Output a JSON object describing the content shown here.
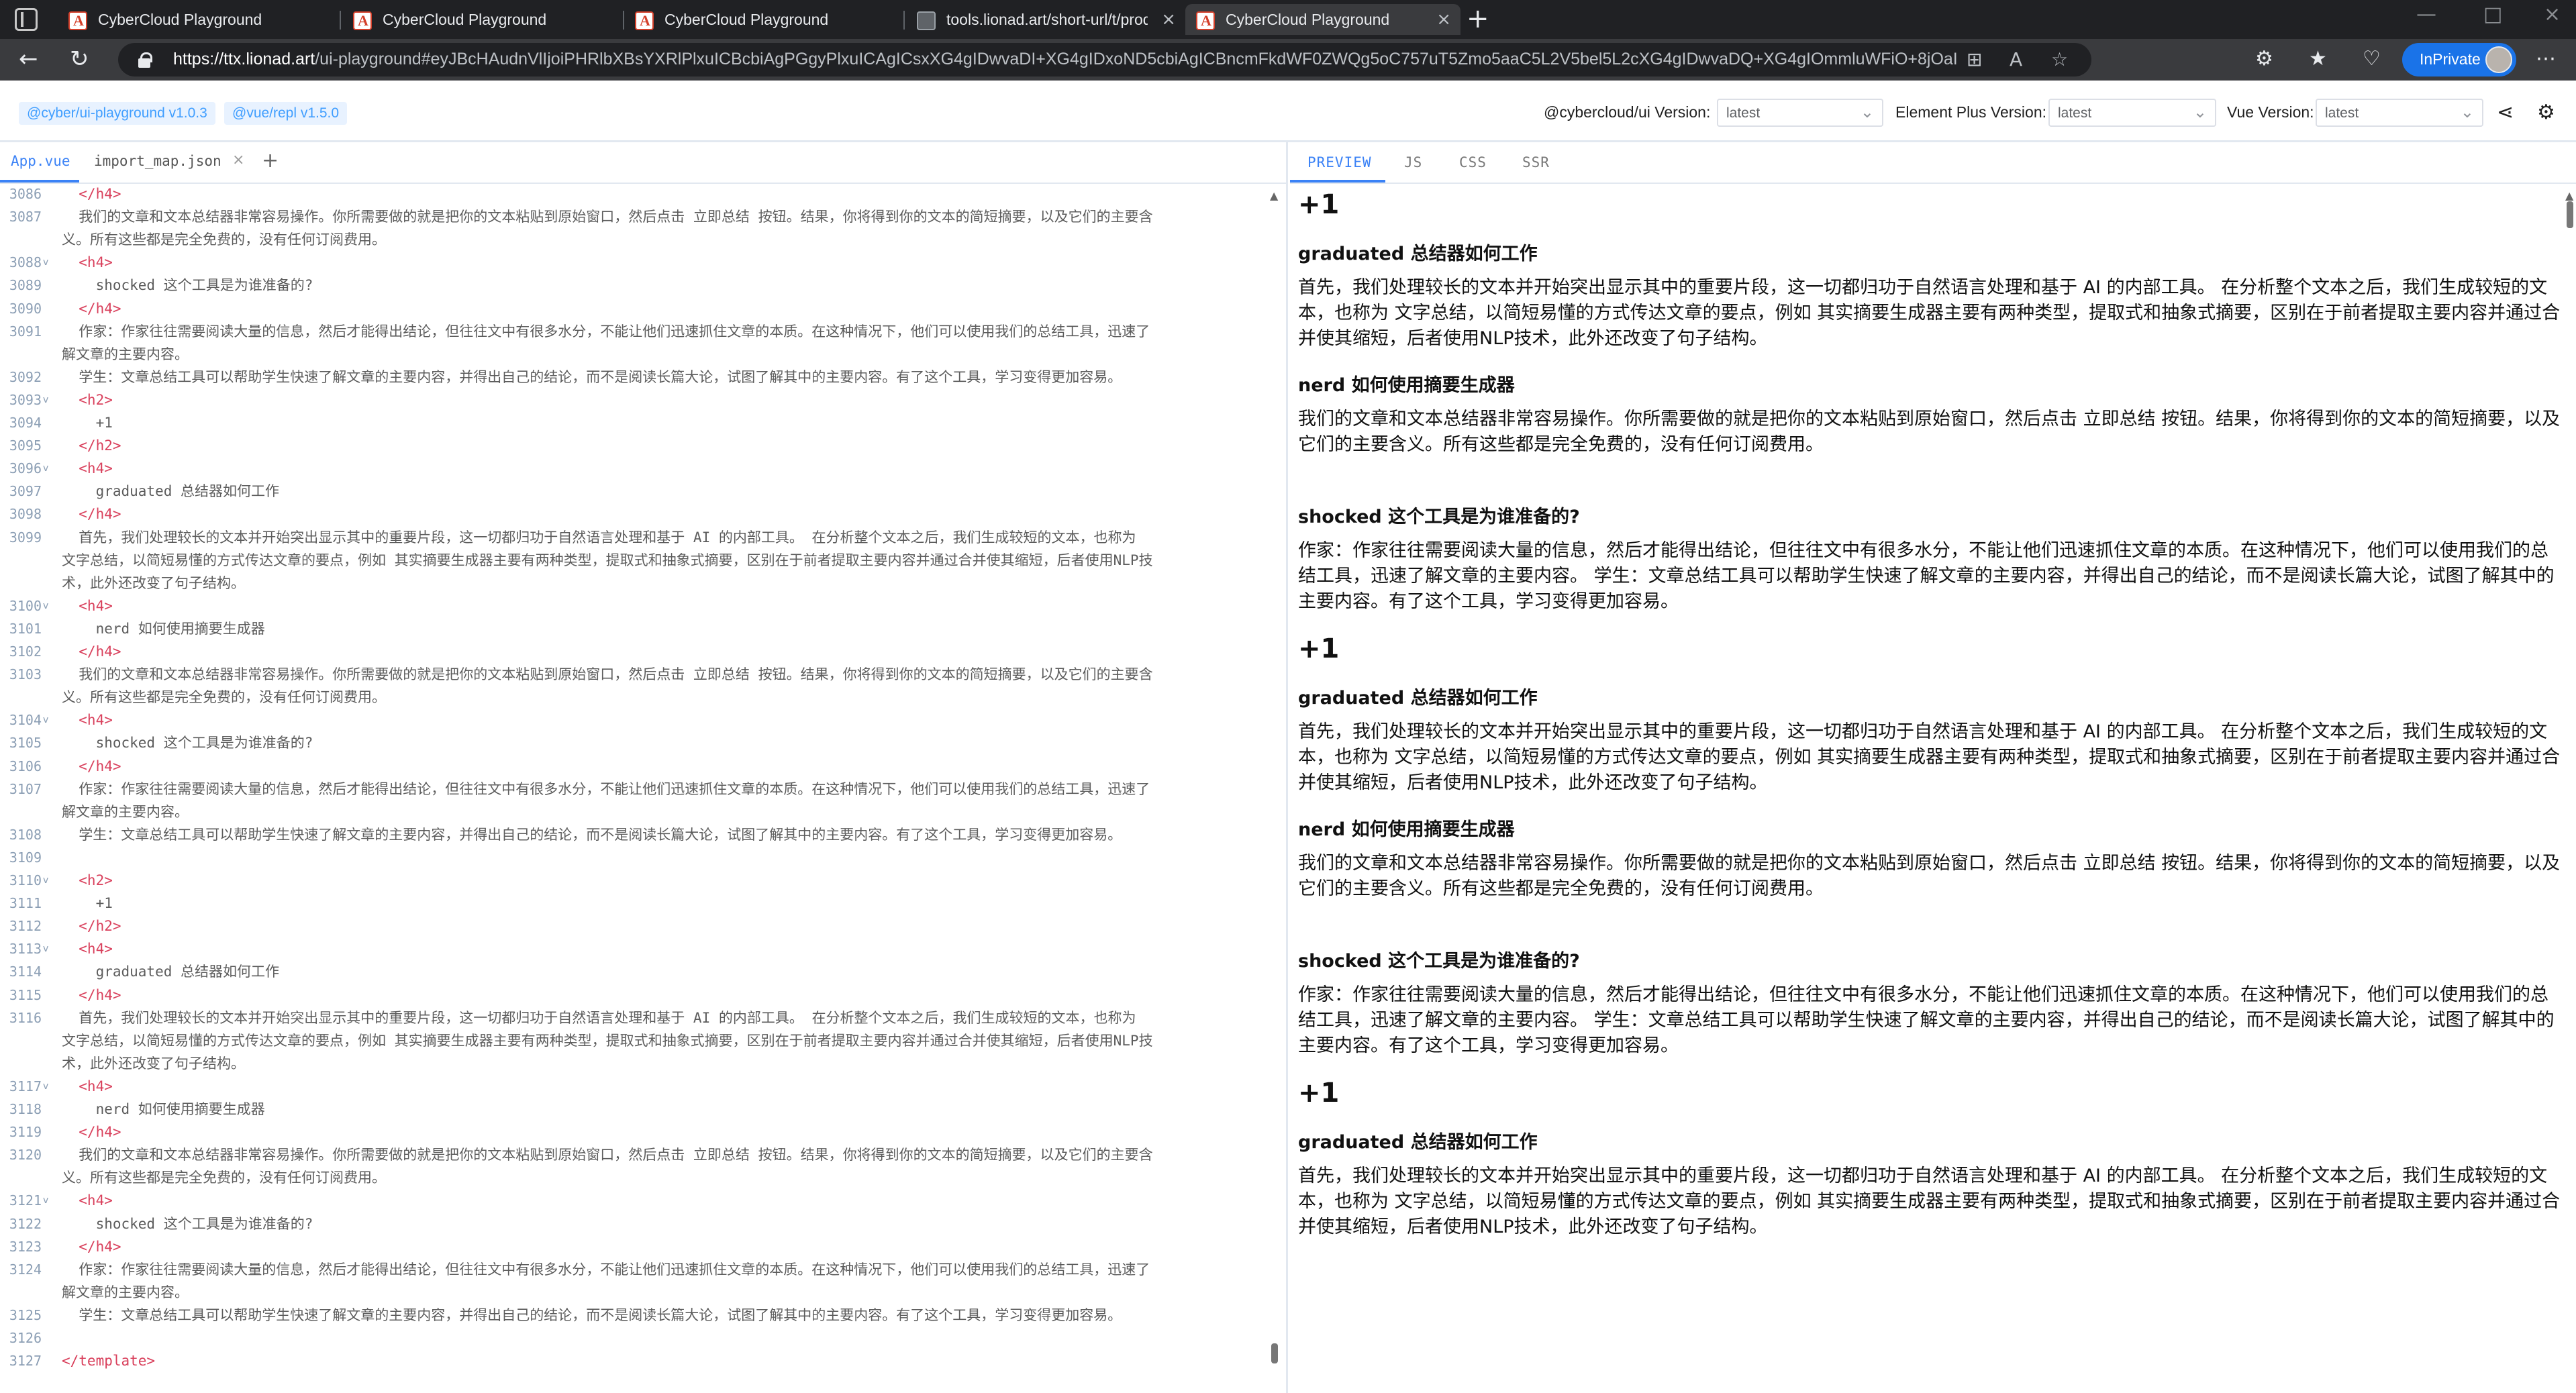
{
  "browser": {
    "tabs": [
      {
        "title": "CyberCloud Playground"
      },
      {
        "title": "CyberCloud Playground"
      },
      {
        "title": "CyberCloud Playground"
      },
      {
        "title": "tools.lionad.art/short-url/t/prod/"
      },
      {
        "title": "CyberCloud Playground"
      }
    ],
    "url_host": "https://ttx.lionad.art",
    "url_rest": "/ui-playground#eyJBcHAudnVlIjoiPHRlbXBsYXRlPlxuICBcbiAgPGgyPlxuICAgICsxXG4gIDwvaDI+XG4gIDxoND5cbiAgICBncmFkdWF0ZWQg5oC757uT5Zmo5aaC5L2V5bel5L2cXG4gIDwvaDQ+XG4gIOmmluWFiO+8jOaIkeS7rOWkhOeQhuS+g+mVv...",
    "inprivate_label": "InPrivate"
  },
  "header": {
    "badge_ui": "@cyber/ui-playground v1.0.3",
    "badge_repl": "@vue/repl v1.5.0",
    "cybercloud_label": "@cybercloud/ui Version:",
    "cybercloud_value": "latest",
    "element_label": "Element Plus Version:",
    "element_value": "latest",
    "vue_label": "Vue Version:",
    "vue_value": "latest"
  },
  "editor": {
    "tabs": {
      "app": "App.vue",
      "import_map": "import_map.json",
      "add": "+"
    },
    "lines": [
      {
        "n": "3086",
        "fold": "",
        "cls": "tag",
        "t": "  </h4>"
      },
      {
        "n": "3087",
        "fold": "",
        "cls": "txt",
        "t": "  我们的文章和文本总结器非常容易操作。你所需要做的就是把你的文本粘贴到原始窗口，然后点击 立即总结 按钮。结果，你将得到你的文本的简短摘要，以及它们的主要含"
      },
      {
        "n": "",
        "fold": "",
        "cls": "txt",
        "t": "义。所有这些都是完全免费的，没有任何订阅费用。"
      },
      {
        "n": "3088",
        "fold": "v",
        "cls": "tag",
        "t": "  <h4>"
      },
      {
        "n": "3089",
        "fold": "",
        "cls": "txt",
        "t": "    shocked 这个工具是为谁准备的?"
      },
      {
        "n": "3090",
        "fold": "",
        "cls": "tag",
        "t": "  </h4>"
      },
      {
        "n": "3091",
        "fold": "",
        "cls": "txt",
        "t": "  作家：作家往往需要阅读大量的信息，然后才能得出结论，但往往文中有很多水分，不能让他们迅速抓住文章的本质。在这种情况下，他们可以使用我们的总结工具，迅速了"
      },
      {
        "n": "",
        "fold": "",
        "cls": "txt",
        "t": "解文章的主要内容。"
      },
      {
        "n": "3092",
        "fold": "",
        "cls": "txt",
        "t": "  学生：文章总结工具可以帮助学生快速了解文章的主要内容，并得出自己的结论，而不是阅读长篇大论，试图了解其中的主要内容。有了这个工具，学习变得更加容易。"
      },
      {
        "n": "3093",
        "fold": "v",
        "cls": "tag",
        "t": "  <h2>"
      },
      {
        "n": "3094",
        "fold": "",
        "cls": "txt",
        "t": "    +1"
      },
      {
        "n": "3095",
        "fold": "",
        "cls": "tag",
        "t": "  </h2>"
      },
      {
        "n": "3096",
        "fold": "v",
        "cls": "tag",
        "t": "  <h4>"
      },
      {
        "n": "3097",
        "fold": "",
        "cls": "txt",
        "t": "    graduated 总结器如何工作"
      },
      {
        "n": "3098",
        "fold": "",
        "cls": "tag",
        "t": "  </h4>"
      },
      {
        "n": "3099",
        "fold": "",
        "cls": "txt",
        "t": "  首先，我们处理较长的文本并开始突出显示其中的重要片段，这一切都归功于自然语言处理和基于 AI 的内部工具。 在分析整个文本之后，我们生成较短的文本，也称为"
      },
      {
        "n": "",
        "fold": "",
        "cls": "txt",
        "t": "文字总结，以简短易懂的方式传达文章的要点，例如 其实摘要生成器主要有两种类型，提取式和抽象式摘要，区别在于前者提取主要内容并通过合并使其缩短，后者使用NLP技"
      },
      {
        "n": "",
        "fold": "",
        "cls": "txt",
        "t": "术，此外还改变了句子结构。"
      },
      {
        "n": "3100",
        "fold": "v",
        "cls": "tag",
        "t": "  <h4>"
      },
      {
        "n": "3101",
        "fold": "",
        "cls": "txt",
        "t": "    nerd 如何使用摘要生成器"
      },
      {
        "n": "3102",
        "fold": "",
        "cls": "tag",
        "t": "  </h4>"
      },
      {
        "n": "3103",
        "fold": "",
        "cls": "txt",
        "t": "  我们的文章和文本总结器非常容易操作。你所需要做的就是把你的文本粘贴到原始窗口，然后点击 立即总结 按钮。结果，你将得到你的文本的简短摘要，以及它们的主要含"
      },
      {
        "n": "",
        "fold": "",
        "cls": "txt",
        "t": "义。所有这些都是完全免费的，没有任何订阅费用。"
      },
      {
        "n": "3104",
        "fold": "v",
        "cls": "tag",
        "t": "  <h4>"
      },
      {
        "n": "3105",
        "fold": "",
        "cls": "txt",
        "t": "    shocked 这个工具是为谁准备的?"
      },
      {
        "n": "3106",
        "fold": "",
        "cls": "tag",
        "t": "  </h4>"
      },
      {
        "n": "3107",
        "fold": "",
        "cls": "txt",
        "t": "  作家：作家往往需要阅读大量的信息，然后才能得出结论，但往往文中有很多水分，不能让他们迅速抓住文章的本质。在这种情况下，他们可以使用我们的总结工具，迅速了"
      },
      {
        "n": "",
        "fold": "",
        "cls": "txt",
        "t": "解文章的主要内容。"
      },
      {
        "n": "3108",
        "fold": "",
        "cls": "txt",
        "t": "  学生：文章总结工具可以帮助学生快速了解文章的主要内容，并得出自己的结论，而不是阅读长篇大论，试图了解其中的主要内容。有了这个工具，学习变得更加容易。"
      },
      {
        "n": "3109",
        "fold": "",
        "cls": "txt",
        "t": ""
      },
      {
        "n": "3110",
        "fold": "v",
        "cls": "tag",
        "t": "  <h2>"
      },
      {
        "n": "3111",
        "fold": "",
        "cls": "txt",
        "t": "    +1"
      },
      {
        "n": "3112",
        "fold": "",
        "cls": "tag",
        "t": "  </h2>"
      },
      {
        "n": "3113",
        "fold": "v",
        "cls": "tag",
        "t": "  <h4>"
      },
      {
        "n": "3114",
        "fold": "",
        "cls": "txt",
        "t": "    graduated 总结器如何工作"
      },
      {
        "n": "3115",
        "fold": "",
        "cls": "tag",
        "t": "  </h4>"
      },
      {
        "n": "3116",
        "fold": "",
        "cls": "txt",
        "t": "  首先，我们处理较长的文本并开始突出显示其中的重要片段，这一切都归功于自然语言处理和基于 AI 的内部工具。 在分析整个文本之后，我们生成较短的文本，也称为"
      },
      {
        "n": "",
        "fold": "",
        "cls": "txt",
        "t": "文字总结，以简短易懂的方式传达文章的要点，例如 其实摘要生成器主要有两种类型，提取式和抽象式摘要，区别在于前者提取主要内容并通过合并使其缩短，后者使用NLP技"
      },
      {
        "n": "",
        "fold": "",
        "cls": "txt",
        "t": "术，此外还改变了句子结构。"
      },
      {
        "n": "3117",
        "fold": "v",
        "cls": "tag",
        "t": "  <h4>"
      },
      {
        "n": "3118",
        "fold": "",
        "cls": "txt",
        "t": "    nerd 如何使用摘要生成器"
      },
      {
        "n": "3119",
        "fold": "",
        "cls": "tag",
        "t": "  </h4>"
      },
      {
        "n": "3120",
        "fold": "",
        "cls": "txt",
        "t": "  我们的文章和文本总结器非常容易操作。你所需要做的就是把你的文本粘贴到原始窗口，然后点击 立即总结 按钮。结果，你将得到你的文本的简短摘要，以及它们的主要含"
      },
      {
        "n": "",
        "fold": "",
        "cls": "txt",
        "t": "义。所有这些都是完全免费的，没有任何订阅费用。"
      },
      {
        "n": "3121",
        "fold": "v",
        "cls": "tag",
        "t": "  <h4>"
      },
      {
        "n": "3122",
        "fold": "",
        "cls": "txt",
        "t": "    shocked 这个工具是为谁准备的?"
      },
      {
        "n": "3123",
        "fold": "",
        "cls": "tag",
        "t": "  </h4>"
      },
      {
        "n": "3124",
        "fold": "",
        "cls": "txt",
        "t": "  作家：作家往往需要阅读大量的信息，然后才能得出结论，但往往文中有很多水分，不能让他们迅速抓住文章的本质。在这种情况下，他们可以使用我们的总结工具，迅速了"
      },
      {
        "n": "",
        "fold": "",
        "cls": "txt",
        "t": "解文章的主要内容。"
      },
      {
        "n": "3125",
        "fold": "",
        "cls": "txt",
        "t": "  学生：文章总结工具可以帮助学生快速了解文章的主要内容，并得出自己的结论，而不是阅读长篇大论，试图了解其中的主要内容。有了这个工具，学习变得更加容易。"
      },
      {
        "n": "3126",
        "fold": "",
        "cls": "txt",
        "t": ""
      },
      {
        "n": "3127",
        "fold": "",
        "cls": "tag",
        "t": "</template>"
      }
    ]
  },
  "preview": {
    "tabs": {
      "preview": "PREVIEW",
      "js": "JS",
      "css": "CSS",
      "ssr": "SSR"
    },
    "blocks": [
      {
        "type": "h2",
        "text": "+1"
      },
      {
        "type": "h4",
        "text": "graduated 总结器如何工作"
      },
      {
        "type": "p",
        "text": "首先，我们处理较长的文本并开始突出显示其中的重要片段，这一切都归功于自然语言处理和基于 AI 的内部工具。 在分析整个文本之后，我们生成较短的文本，也称为 文字总结，以简短易懂的方式传达文章的要点，例如 其实摘要生成器主要有两种类型，提取式和抽象式摘要，区别在于前者提取主要内容并通过合并使其缩短，后者使用NLP技术，此外还改变了句子结构。"
      },
      {
        "type": "h4",
        "text": "nerd 如何使用摘要生成器"
      },
      {
        "type": "p",
        "text": "我们的文章和文本总结器非常容易操作。你所需要做的就是把你的文本粘贴到原始窗口，然后点击 立即总结 按钮。结果，你将得到你的文本的简短摘要，以及它们的主要含义。所有这些都是完全免费的，没有任何订阅费用。"
      },
      {
        "type": "h4",
        "text": "shocked 这个工具是为谁准备的?"
      },
      {
        "type": "p",
        "text": "作家：作家往往需要阅读大量的信息，然后才能得出结论，但往往文中有很多水分，不能让他们迅速抓住文章的本质。在这种情况下，他们可以使用我们的总结工具，迅速了解文章的主要内容。 学生：文章总结工具可以帮助学生快速了解文章的主要内容，并得出自己的结论，而不是阅读长篇大论，试图了解其中的主要内容。有了这个工具，学习变得更加容易。"
      },
      {
        "type": "h2",
        "text": "+1"
      },
      {
        "type": "h4",
        "text": "graduated 总结器如何工作"
      },
      {
        "type": "p",
        "text": "首先，我们处理较长的文本并开始突出显示其中的重要片段，这一切都归功于自然语言处理和基于 AI 的内部工具。 在分析整个文本之后，我们生成较短的文本，也称为 文字总结，以简短易懂的方式传达文章的要点，例如 其实摘要生成器主要有两种类型，提取式和抽象式摘要，区别在于前者提取主要内容并通过合并使其缩短，后者使用NLP技术，此外还改变了句子结构。"
      },
      {
        "type": "h4",
        "text": "nerd 如何使用摘要生成器"
      },
      {
        "type": "p",
        "text": "我们的文章和文本总结器非常容易操作。你所需要做的就是把你的文本粘贴到原始窗口，然后点击 立即总结 按钮。结果，你将得到你的文本的简短摘要，以及它们的主要含义。所有这些都是完全免费的，没有任何订阅费用。"
      },
      {
        "type": "h4",
        "text": "shocked 这个工具是为谁准备的?"
      },
      {
        "type": "p",
        "text": "作家：作家往往需要阅读大量的信息，然后才能得出结论，但往往文中有很多水分，不能让他们迅速抓住文章的本质。在这种情况下，他们可以使用我们的总结工具，迅速了解文章的主要内容。 学生：文章总结工具可以帮助学生快速了解文章的主要内容，并得出自己的结论，而不是阅读长篇大论，试图了解其中的主要内容。有了这个工具，学习变得更加容易。"
      },
      {
        "type": "h2",
        "text": "+1"
      },
      {
        "type": "h4",
        "text": "graduated 总结器如何工作"
      },
      {
        "type": "p",
        "text": "首先，我们处理较长的文本并开始突出显示其中的重要片段，这一切都归功于自然语言处理和基于 AI 的内部工具。 在分析整个文本之后，我们生成较短的文本，也称为 文字总结，以简短易懂的方式传达文章的要点，例如 其实摘要生成器主要有两种类型，提取式和抽象式摘要，区别在于前者提取主要内容并通过合并使其缩短，后者使用NLP技术，此外还改变了句子结构。"
      }
    ]
  }
}
